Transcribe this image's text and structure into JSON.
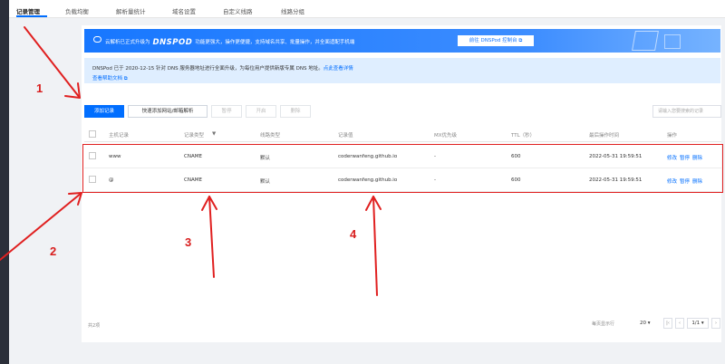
{
  "tabs": [
    {
      "label": "记录管理",
      "active": true
    },
    {
      "label": "负载均衡"
    },
    {
      "label": "解析量统计"
    },
    {
      "label": "域名设置"
    },
    {
      "label": "自定义线路"
    },
    {
      "label": "线路分组"
    }
  ],
  "banner": {
    "text_prefix": "云解析已正式升级为",
    "logo": "DNSPOD",
    "text_suffix": "功能更强大，操作更便捷，支持域名共享、批量操作，并全面适配手机端",
    "button": "前往 DNSPod 控制台 ⧉"
  },
  "notice": {
    "line1": "DNSPod 已于 2020-12-15 针对 DNS 服务器地址进行全面升级，为每位用户提供新版专属 DNS 地址。",
    "line1_link": "点此查看详情",
    "line2": "查看帮助文档 ⧉"
  },
  "toolbar": {
    "add": "添加记录",
    "quick_add": "快速添加网站/邮箱解析",
    "pause": "暂停",
    "enable": "开启",
    "delete": "删除",
    "search_placeholder": "请输入您要搜索的记录"
  },
  "table": {
    "headers": {
      "host": "主机记录",
      "type": "记录类型",
      "line": "线路类型",
      "value": "记录值",
      "mx": "MX优先级",
      "ttl": "TTL（秒）",
      "time": "最后操作时间",
      "ops": "操作"
    },
    "filter_icon": "filter-icon",
    "rows": [
      {
        "host": "www",
        "type": "CNAME",
        "line": "默认",
        "value": "coderwanfeng.github.io",
        "mx": "-",
        "ttl": "600",
        "time": "2022-05-31 19:59:51"
      },
      {
        "host": "@",
        "type": "CNAME",
        "line": "默认",
        "value": "coderwanfeng.github.io",
        "mx": "-",
        "ttl": "600",
        "time": "2022-05-31 19:59:51"
      }
    ],
    "row_ops": [
      "修改",
      "暂停",
      "删除"
    ]
  },
  "footer": {
    "total": "共2项",
    "per_page_label": "每页显示行",
    "per_page": "20 ▾",
    "page": "1/1 ▾",
    "first": "|‹",
    "prev": "‹",
    "next": "›"
  },
  "annotations": [
    "1",
    "2",
    "3",
    "4"
  ],
  "colors": {
    "primary": "#006eff",
    "annotation": "#e02020",
    "notice_bg": "#dfeeff"
  }
}
